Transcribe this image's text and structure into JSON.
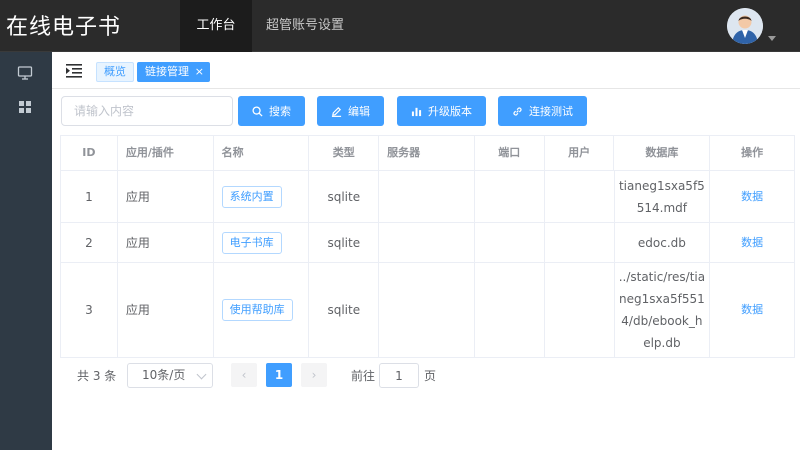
{
  "app": {
    "title": "在线电子书"
  },
  "topnav": {
    "items": [
      {
        "label": "工作台"
      },
      {
        "label": "超管账号设置"
      }
    ]
  },
  "tabs": {
    "overview": "概览",
    "active": "链接管理",
    "close": "×"
  },
  "search": {
    "placeholder": "请输入内容",
    "value": ""
  },
  "toolbar": {
    "search": "搜索",
    "edit": "编辑",
    "upgrade": "升级版本",
    "test": "连接测试"
  },
  "table": {
    "headers": [
      "ID",
      "应用/插件",
      "名称",
      "类型",
      "服务器",
      "端口",
      "用户",
      "数据库",
      "操作"
    ],
    "rows": [
      {
        "id": "1",
        "app": "应用",
        "name": "系统内置",
        "type": "sqlite",
        "server": "",
        "port": "",
        "user": "",
        "db": "tianeg1sxa5f5514.mdf",
        "action": "数据"
      },
      {
        "id": "2",
        "app": "应用",
        "name": "电子书库",
        "type": "sqlite",
        "server": "",
        "port": "",
        "user": "",
        "db": "edoc.db",
        "action": "数据"
      },
      {
        "id": "3",
        "app": "应用",
        "name": "使用帮助库",
        "type": "sqlite",
        "server": "",
        "port": "",
        "user": "",
        "db": "../static/res/tianeg1sxa5f5514/db/ebook_help.db",
        "action": "数据"
      }
    ]
  },
  "pagination": {
    "total": "共 3 条",
    "page_size": "10条/页",
    "prev": "‹",
    "current": "1",
    "next": "›",
    "goto_label": "前往",
    "goto_value": "1",
    "goto_suffix": "页"
  },
  "colors": {
    "primary": "#409eff",
    "topbar": "#2b2b2b",
    "sidebar": "#2f3a45"
  },
  "icons": [
    "monitor-icon",
    "grid-icon",
    "menu-indent-icon",
    "search-icon",
    "edit-icon",
    "bar-chart-icon",
    "link-icon",
    "user-avatar"
  ]
}
